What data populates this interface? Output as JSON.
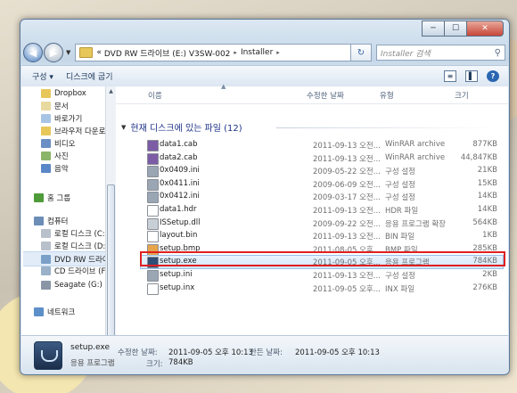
{
  "window": {
    "buttons": {
      "minimize": "─",
      "maximize": "☐",
      "close": "✕"
    }
  },
  "address": {
    "overflow": "«",
    "segments": [
      "DVD RW 드라이브 (E:) V3SW-002",
      "Installer"
    ],
    "sep": "▸",
    "refresh": "↻"
  },
  "search": {
    "placeholder": "Installer 검색",
    "icon": "search-icon"
  },
  "toolbar": {
    "organize": "구성 ▾",
    "burn": "디스크에 굽기"
  },
  "sidebar": {
    "items": [
      {
        "label": "Dropbox",
        "icon": "folder-icon"
      },
      {
        "label": "문서",
        "icon": "documents-icon"
      },
      {
        "label": "바로가기",
        "icon": "shortcut-icon"
      },
      {
        "label": "브라우저 다운로",
        "icon": "folder-icon"
      },
      {
        "label": "비디오",
        "icon": "video-icon"
      },
      {
        "label": "사진",
        "icon": "pictures-icon"
      },
      {
        "label": "음악",
        "icon": "music-icon"
      },
      {
        "label": "홈 그룹",
        "icon": "homegroup-icon"
      },
      {
        "label": "컴퓨터",
        "icon": "computer-icon"
      },
      {
        "label": "로컬 디스크 (C:",
        "icon": "drive-icon"
      },
      {
        "label": "로컬 디스크 (D:",
        "icon": "drive-icon"
      },
      {
        "label": "DVD RW 드라이",
        "icon": "dvd-drive-icon",
        "selected": true
      },
      {
        "label": "CD 드라이브 (F",
        "icon": "cd-drive-icon"
      },
      {
        "label": "Seagate (G:)",
        "icon": "usb-drive-icon"
      },
      {
        "label": "네트워크",
        "icon": "network-icon"
      }
    ]
  },
  "columns": {
    "name": "이름",
    "date": "수정한 날짜",
    "type": "유형",
    "size": "크기",
    "sort": "▲"
  },
  "group": {
    "label": "현재 디스크에 있는 파일 (12)",
    "chevron": "▼"
  },
  "files": [
    {
      "name": "data1.cab",
      "date": "2011-09-13 오전...",
      "type": "WinRAR archive",
      "size": "877KB",
      "color": "#7d5ca6"
    },
    {
      "name": "data2.cab",
      "date": "2011-09-13 오전...",
      "type": "WinRAR archive",
      "size": "44,847KB",
      "color": "#7d5ca6"
    },
    {
      "name": "0x0409.ini",
      "date": "2009-05-22 오전...",
      "type": "구성 설정",
      "size": "21KB",
      "color": "#9aa6b3"
    },
    {
      "name": "0x0411.ini",
      "date": "2009-06-09 오전...",
      "type": "구성 설정",
      "size": "15KB",
      "color": "#9aa6b3"
    },
    {
      "name": "0x0412.ini",
      "date": "2009-03-17 오전...",
      "type": "구성 설정",
      "size": "14KB",
      "color": "#9aa6b3"
    },
    {
      "name": "data1.hdr",
      "date": "2011-09-13 오전...",
      "type": "HDR 파일",
      "size": "14KB",
      "color": "#ffffff"
    },
    {
      "name": "ISSetup.dll",
      "date": "2009-09-22 오전...",
      "type": "응용 프로그램 확장",
      "size": "564KB",
      "color": "#c9cfd6"
    },
    {
      "name": "layout.bin",
      "date": "2011-09-13 오전...",
      "type": "BIN 파일",
      "size": "1KB",
      "color": "#ffffff"
    },
    {
      "name": "setup.bmp",
      "date": "2011-08-05 오후...",
      "type": "BMP 파일",
      "size": "285KB",
      "color": "#e7a54b"
    },
    {
      "name": "setup.exe",
      "date": "2011-09-05 오후...",
      "type": "응용 프로그램",
      "size": "784KB",
      "color": "#2f4d75",
      "highlight": true
    },
    {
      "name": "setup.ini",
      "date": "2011-09-13 오전...",
      "type": "구성 설정",
      "size": "2KB",
      "color": "#9aa6b3"
    },
    {
      "name": "setup.inx",
      "date": "2011-09-05 오후...",
      "type": "INX 파일",
      "size": "276KB",
      "color": "#ffffff"
    }
  ],
  "status": {
    "name": "setup.exe",
    "type": "응용 프로그램",
    "modified_label": "수정한 날짜:",
    "modified_value": "2011-09-05 오후 10:13",
    "created_label": "만든 날짜:",
    "created_value": "2011-09-05 오후 10:13",
    "size_label": "크기:",
    "size_value": "784KB"
  }
}
